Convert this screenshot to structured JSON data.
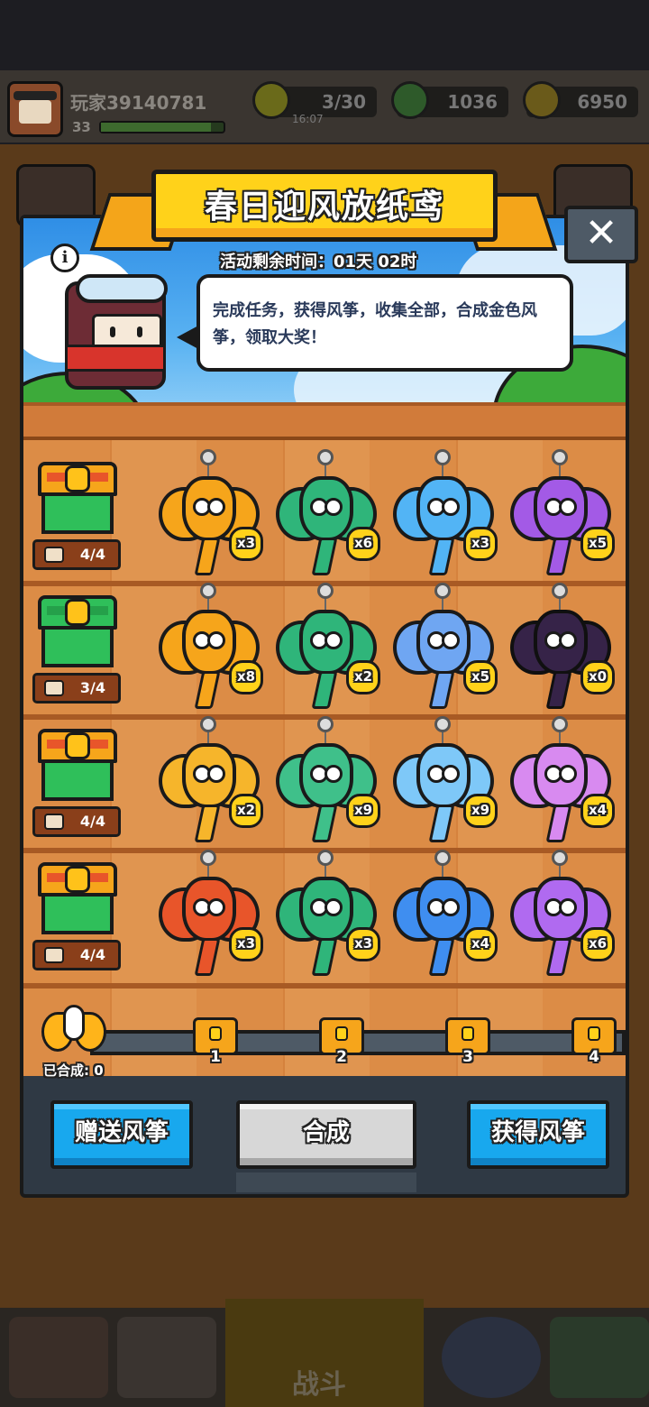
{
  "player": {
    "name": "玩家39140781",
    "level": "33",
    "xp_fraction": 0.9
  },
  "resources": {
    "energy": "3/30",
    "energy_timer": "16:07",
    "gems": "1036",
    "coins": "6950"
  },
  "modal": {
    "title": "春日迎风放纸鸢",
    "timer_label": "活动剩余时间：01天 02时",
    "info_icon": "i",
    "close_icon": "✕",
    "description": "完成任务，获得风筝，收集全部，合成金色风筝，领取大奖！"
  },
  "rows": [
    {
      "progress": "4/4",
      "chest_color": "orange",
      "kites": [
        {
          "count": "x3",
          "color": "#f6a51b",
          "shape": "cat"
        },
        {
          "count": "x6",
          "color": "#2fb57a",
          "shape": "cat"
        },
        {
          "count": "x3",
          "color": "#52b4f5",
          "shape": "cat"
        },
        {
          "count": "x5",
          "color": "#a35ae6",
          "shape": "cat"
        }
      ]
    },
    {
      "progress": "3/4",
      "chest_color": "green",
      "kites": [
        {
          "count": "x8",
          "color": "#f6a51b",
          "shape": "beetle"
        },
        {
          "count": "x2",
          "color": "#2fb57a",
          "shape": "beetle"
        },
        {
          "count": "x5",
          "color": "#6fa6f2",
          "shape": "beetle"
        },
        {
          "count": "x0",
          "color": "#5a3a78",
          "shape": "beetle"
        }
      ]
    },
    {
      "progress": "4/4",
      "chest_color": "orange",
      "kites": [
        {
          "count": "x2",
          "color": "#f6b52b",
          "shape": "butterfly"
        },
        {
          "count": "x9",
          "color": "#3fc08a",
          "shape": "butterfly"
        },
        {
          "count": "x9",
          "color": "#7ec8f8",
          "shape": "butterfly"
        },
        {
          "count": "x4",
          "color": "#d88af0",
          "shape": "butterfly"
        }
      ]
    },
    {
      "progress": "4/4",
      "chest_color": "orange",
      "kites": [
        {
          "count": "x3",
          "color": "#e8552a",
          "shape": "bird"
        },
        {
          "count": "x3",
          "color": "#2fb57a",
          "shape": "bird"
        },
        {
          "count": "x4",
          "color": "#3f8ef0",
          "shape": "bird"
        },
        {
          "count": "x6",
          "color": "#b06af0",
          "shape": "bird"
        }
      ]
    }
  ],
  "synthesis": {
    "label": "已合成: 0",
    "milestones": [
      "1",
      "2",
      "3",
      "4"
    ]
  },
  "buttons": {
    "gift": "赠送风筝",
    "synthesize": "合成",
    "obtain": "获得风筝"
  },
  "nav": {
    "battle": "战斗"
  }
}
